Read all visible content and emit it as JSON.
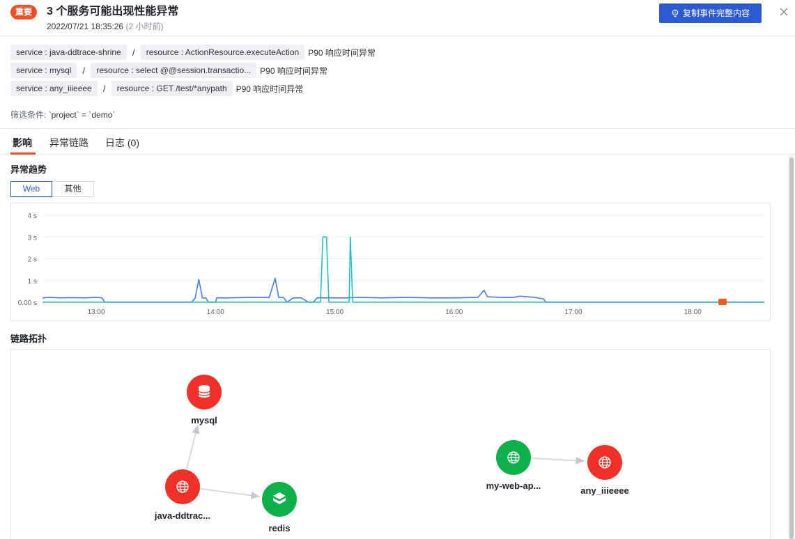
{
  "header": {
    "badge": "重要",
    "title": "3 个服务可能出现性能异常",
    "time": "2022/07/21 18:35:26",
    "ago": "(2 小时前)",
    "copy_button": "复制事件完整内容"
  },
  "services": [
    {
      "service": "service : java-ddtrace-shrine",
      "resource": "resource : ActionResource.executeAction",
      "desc": "P90 响应时间异常"
    },
    {
      "service": "service : mysql",
      "resource": "resource : select @@session.transactio...",
      "desc": "P90 响应时间异常"
    },
    {
      "service": "service : any_iiieeee",
      "resource": "resource : GET /test/*anypath",
      "desc": "P90 响应时间异常"
    }
  ],
  "filter": {
    "label": "筛选条件:",
    "value": "`project` = `demo`"
  },
  "tabs": [
    "影响",
    "异常链路",
    "日志 (0)"
  ],
  "trend": {
    "title": "异常趋势",
    "segments": [
      "Web",
      "其他"
    ],
    "active_segment": "Web"
  },
  "topology": {
    "title": "链路拓扑",
    "nodes": [
      {
        "label": "mysql",
        "status": "error",
        "icon": "database-icon"
      },
      {
        "label": "java-ddtrac...",
        "status": "error",
        "icon": "globe-icon"
      },
      {
        "label": "redis",
        "status": "ok",
        "icon": "cache-icon"
      },
      {
        "label": "my-web-ap...",
        "status": "ok",
        "icon": "globe-icon"
      },
      {
        "label": "any_iiieeee",
        "status": "error",
        "icon": "globe-icon"
      }
    ],
    "edges": [
      [
        "java-ddtrac...",
        "mysql"
      ],
      [
        "java-ddtrac...",
        "redis"
      ],
      [
        "my-web-ap...",
        "any_iiieeee"
      ]
    ]
  },
  "colors": {
    "error": "#f0312a",
    "ok": "#0db04b",
    "series_blue": "#4b7bf2",
    "series_teal": "#1ec4c0",
    "marker": "#f25b1a",
    "primary": "#2c5ad3"
  },
  "chart_data": {
    "type": "line",
    "ylabels": [
      "0.00 s",
      "1 s",
      "2 s",
      "3 s",
      "4 s"
    ],
    "ylim": [
      0,
      4
    ],
    "xlabels": [
      "13:00",
      "14:00",
      "15:00",
      "16:00",
      "17:00",
      "18:00"
    ],
    "x_start_hours": 12.55,
    "x_end_hours": 18.6,
    "series": [
      {
        "color": "#4b7bf2",
        "points": [
          [
            12.55,
            0.2
          ],
          [
            12.6,
            0.22
          ],
          [
            12.7,
            0.2
          ],
          [
            12.8,
            0.21
          ],
          [
            12.9,
            0.2
          ],
          [
            13.0,
            0.22
          ],
          [
            13.05,
            0.2
          ],
          [
            13.07,
            0.01
          ],
          [
            13.1,
            0
          ],
          [
            13.8,
            0
          ],
          [
            13.83,
            0.2
          ],
          [
            13.86,
            1.05
          ],
          [
            13.89,
            0.2
          ],
          [
            13.92,
            0.2
          ],
          [
            13.94,
            0
          ],
          [
            14.0,
            0
          ],
          [
            14.01,
            0.2
          ],
          [
            14.1,
            0.2
          ],
          [
            14.3,
            0.22
          ],
          [
            14.45,
            0.22
          ],
          [
            14.5,
            1.1
          ],
          [
            14.53,
            0.22
          ],
          [
            14.57,
            0.22
          ],
          [
            14.6,
            0
          ],
          [
            14.65,
            0.2
          ],
          [
            14.72,
            0.2
          ],
          [
            14.78,
            0
          ],
          [
            14.82,
            0
          ],
          [
            14.85,
            0.2
          ],
          [
            14.95,
            0.2
          ],
          [
            15.0,
            0.2
          ],
          [
            15.1,
            0.2
          ],
          [
            15.2,
            0.22
          ],
          [
            15.4,
            0.2
          ],
          [
            15.6,
            0.22
          ],
          [
            15.8,
            0.2
          ],
          [
            16.0,
            0.2
          ],
          [
            16.2,
            0.22
          ],
          [
            16.25,
            0.55
          ],
          [
            16.28,
            0.25
          ],
          [
            16.4,
            0.22
          ],
          [
            16.5,
            0.22
          ],
          [
            16.55,
            0.28
          ],
          [
            16.6,
            0.26
          ],
          [
            16.68,
            0.22
          ],
          [
            16.75,
            0.15
          ],
          [
            16.77,
            0
          ],
          [
            18.6,
            0
          ]
        ]
      },
      {
        "color": "#1ec4c0",
        "points": [
          [
            12.55,
            0
          ],
          [
            14.88,
            0
          ],
          [
            14.9,
            3.0
          ],
          [
            14.93,
            3.0
          ],
          [
            14.95,
            0
          ],
          [
            15.12,
            0
          ],
          [
            15.13,
            3.0
          ],
          [
            15.15,
            0
          ],
          [
            18.6,
            0
          ]
        ]
      }
    ],
    "marker": {
      "x": 18.25,
      "y": 0
    }
  }
}
